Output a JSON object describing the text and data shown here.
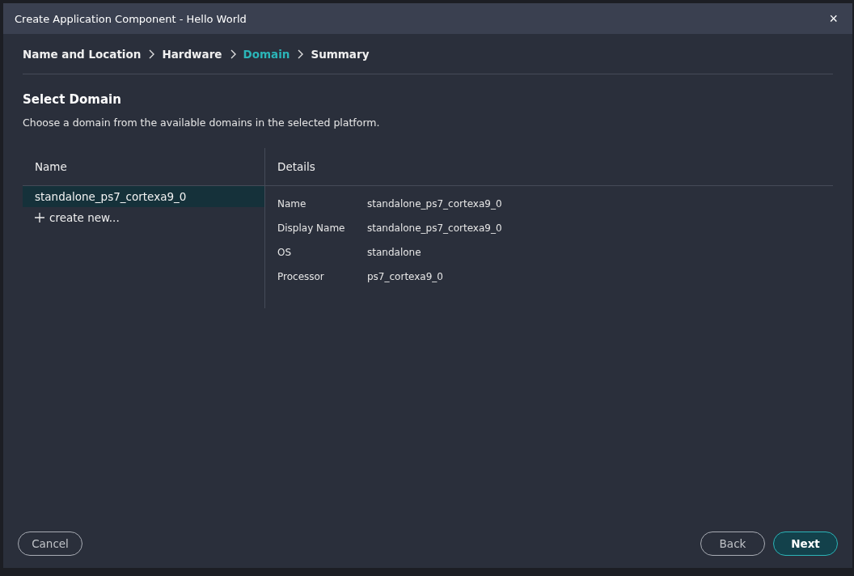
{
  "window": {
    "title": "Create Application Component - Hello World",
    "close": "×"
  },
  "steps": [
    {
      "label": "Name and Location",
      "selected": false
    },
    {
      "label": "Hardware",
      "selected": false
    },
    {
      "label": "Domain",
      "selected": true
    },
    {
      "label": "Summary",
      "selected": false
    }
  ],
  "heading": "Select Domain",
  "description": "Choose a domain from the available domains in the selected platform.",
  "domains": {
    "column": "Name",
    "items": [
      {
        "label": "standalone_ps7_cortexa9_0",
        "selected": true
      }
    ],
    "create": "create new..."
  },
  "details": {
    "column": "Details",
    "rows": [
      {
        "label": "Name",
        "value": "standalone_ps7_cortexa9_0"
      },
      {
        "label": "Display Name",
        "value": "standalone_ps7_cortexa9_0"
      },
      {
        "label": "OS",
        "value": "standalone"
      },
      {
        "label": "Processor",
        "value": "ps7_cortexa9_0"
      }
    ]
  },
  "buttons": {
    "cancel": "Cancel",
    "back": "Back",
    "next": "Next"
  }
}
